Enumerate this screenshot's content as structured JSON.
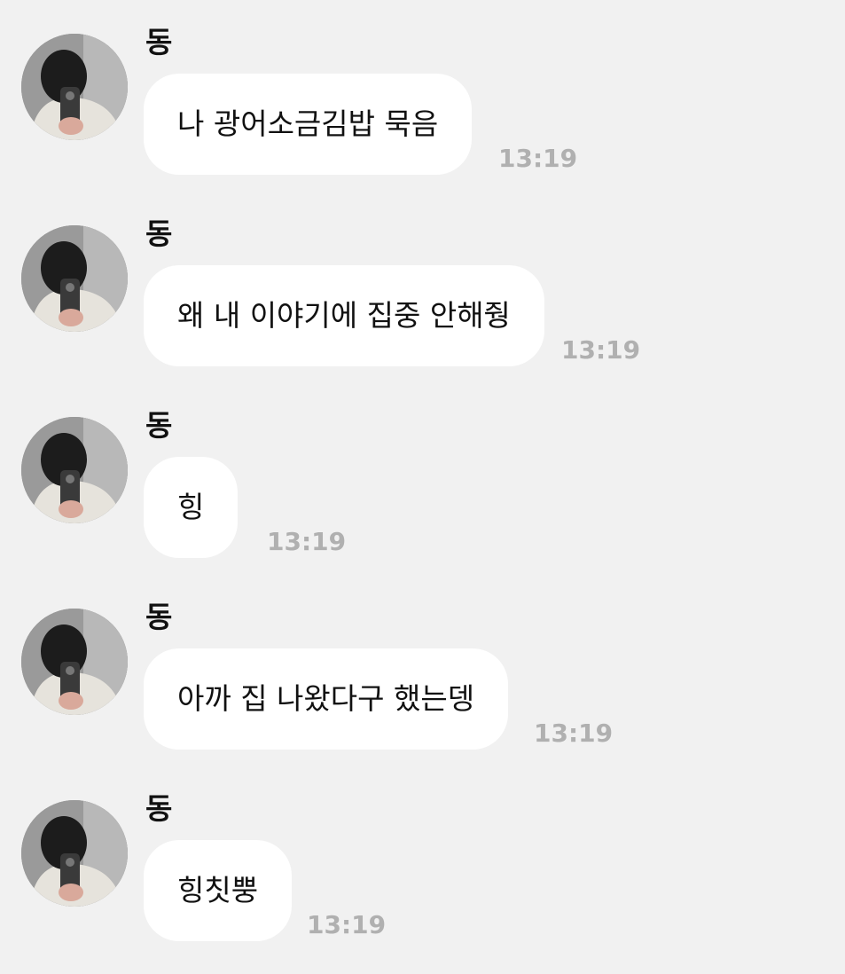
{
  "messages": [
    {
      "sender": "동",
      "text": "나 광어소금김밥 묵음",
      "time": "13:19"
    },
    {
      "sender": "동",
      "text": "왜 내 이야기에 집중 안해줭",
      "time": "13:19"
    },
    {
      "sender": "동",
      "text": "힝",
      "time": "13:19"
    },
    {
      "sender": "동",
      "text": "아까 집 나왔다구 했는뎅",
      "time": "13:19"
    },
    {
      "sender": "동",
      "text": "힝칫뿡",
      "time": "13:19"
    }
  ],
  "colors": {
    "background": "#f1f1f1",
    "bubble": "#ffffff",
    "time": "#b0b0b0"
  },
  "icons": {
    "avatar": "profile-photo"
  }
}
